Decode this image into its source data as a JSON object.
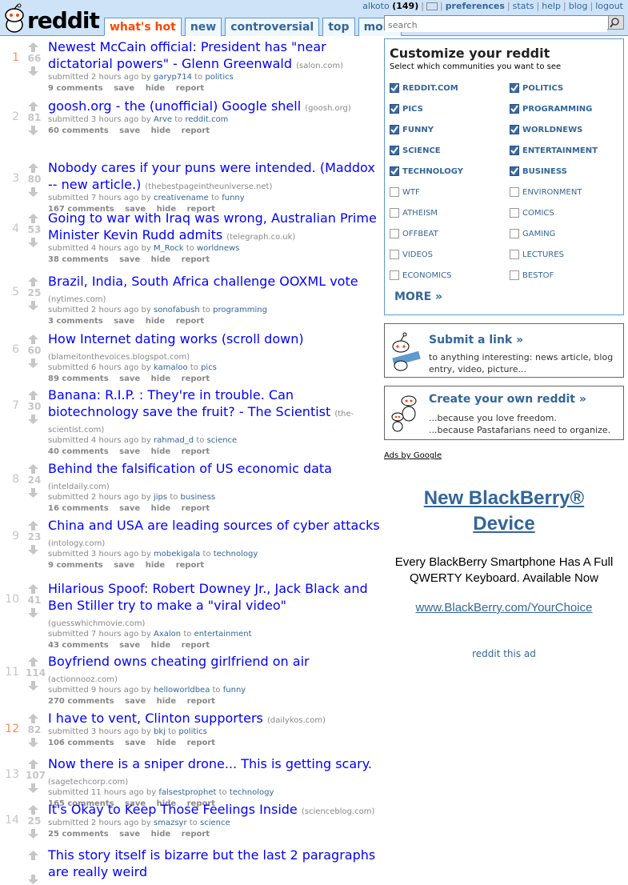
{
  "header": {
    "logo_text": "reddit",
    "tabs": [
      "what's hot",
      "new",
      "controversial",
      "top",
      "more"
    ],
    "user": {
      "name": "alkoto",
      "karma": "(149)"
    },
    "links": [
      "preferences",
      "stats",
      "help",
      "blog",
      "logout"
    ],
    "search_placeholder": "search"
  },
  "colors": {
    "accent": "#ff4500",
    "link": "#0000ff",
    "header_bg": "#cee3f8",
    "sidebar_link": "#336699"
  },
  "links": [
    {
      "rank": "1",
      "score": "66",
      "title": "Newest McCain official: President has \"near dictatorial powers\" - Glenn Greenwald",
      "domain": "(salon.com)",
      "time": "submitted 2 hours ago by",
      "user": "garyp714",
      "sub": "politics",
      "comments": "9 comments"
    },
    {
      "rank": "2",
      "score": "81",
      "title": "goosh.org - the (unofficial) Google shell",
      "domain": "(goosh.org)",
      "time": "submitted 3 hours ago by",
      "user": "Arve",
      "sub": "reddit.com",
      "comments": "60 comments"
    },
    {
      "rank": "3",
      "score": "80",
      "title": "Nobody cares if your puns were intended. (Maddox -- new article.)",
      "domain": "(thebestpageintheuniverse.net)",
      "time": "submitted 7 hours ago by",
      "user": "creativename",
      "sub": "funny",
      "comments": "167 comments"
    },
    {
      "rank": "4",
      "score": "53",
      "title": "Going to war with Iraq was wrong, Australian Prime Minister Kevin Rudd admits",
      "domain": "(telegraph.co.uk)",
      "time": "submitted 4 hours ago by",
      "user": "M_Rock",
      "sub": "worldnews",
      "comments": "38 comments"
    },
    {
      "rank": "5",
      "score": "25",
      "title": "Brazil, India, South Africa challenge OOXML vote",
      "domain": "(nytimes.com)",
      "time": "submitted 2 hours ago by",
      "user": "sonofabush",
      "sub": "programming",
      "comments": "3 comments"
    },
    {
      "rank": "6",
      "score": "60",
      "title": "How Internet dating works (scroll down)",
      "domain": "(blameitonthevoices.blogspot.com)",
      "time": "submitted 6 hours ago by",
      "user": "kamaloo",
      "sub": "pics",
      "comments": "89 comments"
    },
    {
      "rank": "7",
      "score": "30",
      "title": "Banana: R.I.P. : They're in trouble. Can biotechnology save the fruit? - The Scientist",
      "domain": "(the-scientist.com)",
      "time": "submitted 4 hours ago by",
      "user": "rahmad_d",
      "sub": "science",
      "comments": "40 comments"
    },
    {
      "rank": "8",
      "score": "24",
      "title": "Behind the falsification of US economic data",
      "domain": "(inteldaily.com)",
      "time": "submitted 2 hours ago by",
      "user": "jips",
      "sub": "business",
      "comments": "16 comments"
    },
    {
      "rank": "9",
      "score": "23",
      "title": "China and USA are leading sources of cyber attacks",
      "domain": "(intology.com)",
      "time": "submitted 3 hours ago by",
      "user": "mobekigala",
      "sub": "technology",
      "comments": "9 comments"
    },
    {
      "rank": "10",
      "score": "41",
      "title": "Hilarious Spoof: Robert Downey Jr., Jack Black and Ben Stiller try to make a \"viral video\"",
      "domain": "(guesswhichmovie.com)",
      "time": "submitted 7 hours ago by",
      "user": "Axalon",
      "sub": "entertainment",
      "comments": "43 comments"
    },
    {
      "rank": "11",
      "score": "114",
      "title": "Boyfriend owns cheating girlfriend on air",
      "domain": "(actionnooz.com)",
      "time": "submitted 9 hours ago by",
      "user": "helloworldbea",
      "sub": "funny",
      "comments": "270 comments"
    },
    {
      "rank": "12",
      "score": "82",
      "title": "I have to vent, Clinton supporters",
      "domain": "(dailykos.com)",
      "time": "submitted 3 hours ago by",
      "user": "bkj",
      "sub": "politics",
      "comments": "106 comments"
    },
    {
      "rank": "13",
      "score": "107",
      "title": "Now there is a sniper drone... This is getting scary.",
      "domain": "(sagetechcorp.com)",
      "time": "submitted 11 hours ago by",
      "user": "falsestprophet",
      "sub": "technology",
      "comments": "165 comments"
    },
    {
      "rank": "14",
      "score": "25",
      "title": "It's Okay to Keep Those Feelings Inside",
      "domain": "(scienceblog.com)",
      "time": "submitted 2 hours ago by",
      "user": "smazsyr",
      "sub": "science",
      "comments": "25 comments"
    },
    {
      "rank": "",
      "score": "",
      "title": "This story itself is bizarre but the last 2 paragraphs are really weird",
      "domain": "",
      "time": "",
      "user": "",
      "sub": "",
      "comments": ""
    }
  ],
  "actions": {
    "save": "save",
    "hide": "hide",
    "report": "report",
    "to": "to"
  },
  "customize": {
    "title": "Customize your reddit",
    "subtitle": "Select which communities you want to see",
    "options": [
      {
        "label": "REDDIT.COM",
        "checked": true
      },
      {
        "label": "POLITICS",
        "checked": true
      },
      {
        "label": "PICS",
        "checked": true
      },
      {
        "label": "PROGRAMMING",
        "checked": true
      },
      {
        "label": "FUNNY",
        "checked": true
      },
      {
        "label": "WORLDNEWS",
        "checked": true
      },
      {
        "label": "SCIENCE",
        "checked": true
      },
      {
        "label": "ENTERTAINMENT",
        "checked": true
      },
      {
        "label": "TECHNOLOGY",
        "checked": true
      },
      {
        "label": "BUSINESS",
        "checked": true
      },
      {
        "label": "WTF",
        "checked": false
      },
      {
        "label": "ENVIRONMENT",
        "checked": false
      },
      {
        "label": "ATHEISM",
        "checked": false
      },
      {
        "label": "COMICS",
        "checked": false
      },
      {
        "label": "OFFBEAT",
        "checked": false
      },
      {
        "label": "GAMING",
        "checked": false
      },
      {
        "label": "VIDEOS",
        "checked": false
      },
      {
        "label": "LECTURES",
        "checked": false
      },
      {
        "label": "ECONOMICS",
        "checked": false
      },
      {
        "label": "BESTOF",
        "checked": false
      }
    ],
    "more": "MORE »"
  },
  "submit": {
    "title": "Submit a link »",
    "desc": "to anything interesting: news article, blog entry, video, picture..."
  },
  "create": {
    "title": "Create your own reddit »",
    "line1": "...because you love freedom.",
    "line2": "...because Pastafarians need to organize."
  },
  "ads": {
    "label": "Ads by Google",
    "title": "New BlackBerry® Device",
    "body": "Every BlackBerry Smartphone Has A Full QWERTY Keyboard. Available Now",
    "url": "www.BlackBerry.com/YourChoice",
    "reddit_this": "reddit this ad"
  }
}
